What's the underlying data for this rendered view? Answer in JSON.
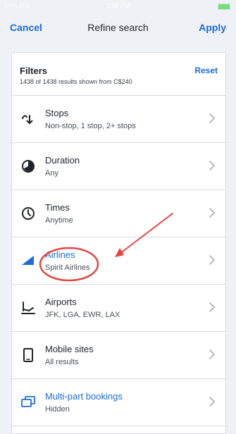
{
  "status_bar": {
    "carrier": "DIALOG",
    "time": "1:48 PM"
  },
  "nav": {
    "cancel": "Cancel",
    "title": "Refine search",
    "apply": "Apply"
  },
  "filters": {
    "title": "Filters",
    "summary": "1438 of 1438 results shown from C$240",
    "reset": "Reset"
  },
  "rows": [
    {
      "label": "Stops",
      "sub": "Non-stop, 1 stop, 2+ stops",
      "icon": "stops-icon"
    },
    {
      "label": "Duration",
      "sub": "Any",
      "icon": "duration-icon"
    },
    {
      "label": "Times",
      "sub": "Anytime",
      "icon": "clock-icon"
    },
    {
      "label": "Airlines",
      "sub": "Spirit Airlines",
      "icon": "airline-tail-icon"
    },
    {
      "label": "Airports",
      "sub": "JFK, LGA, EWR, LAX",
      "icon": "airport-icon"
    },
    {
      "label": "Mobile sites",
      "sub": "All results",
      "icon": "mobile-icon"
    },
    {
      "label": "Multi-part bookings",
      "sub": "Hidden",
      "icon": "multi-booking-icon"
    }
  ],
  "colors": {
    "accent": "#1a6cd6",
    "annotation": "#e5453e"
  }
}
